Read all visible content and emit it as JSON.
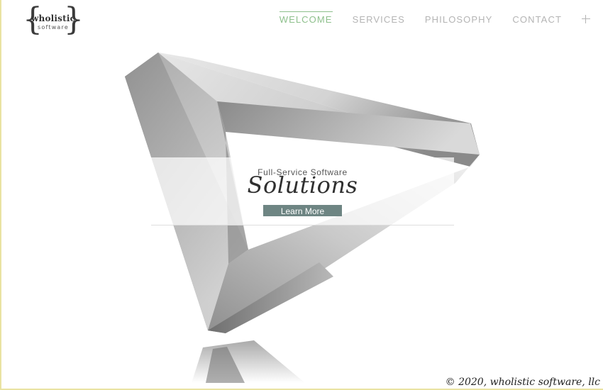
{
  "brand": {
    "name": "wholistic",
    "sub": "software"
  },
  "nav": {
    "items": [
      {
        "label": "WELCOME",
        "active": true
      },
      {
        "label": "SERVICES",
        "active": false
      },
      {
        "label": "PHILOSOPHY",
        "active": false
      },
      {
        "label": "CONTACT",
        "active": false
      }
    ],
    "expand_icon": "plus-icon"
  },
  "hero": {
    "kicker": "Full-Service Software",
    "headline": "Solutions",
    "button_label": "Learn More",
    "background_image": "impossible-triangle"
  },
  "footer": {
    "copyright": "© 2020, wholistic software, llc"
  },
  "colors": {
    "accent": "#8ec08c",
    "nav_text": "#b4b4b4",
    "button": "#6e8583"
  }
}
